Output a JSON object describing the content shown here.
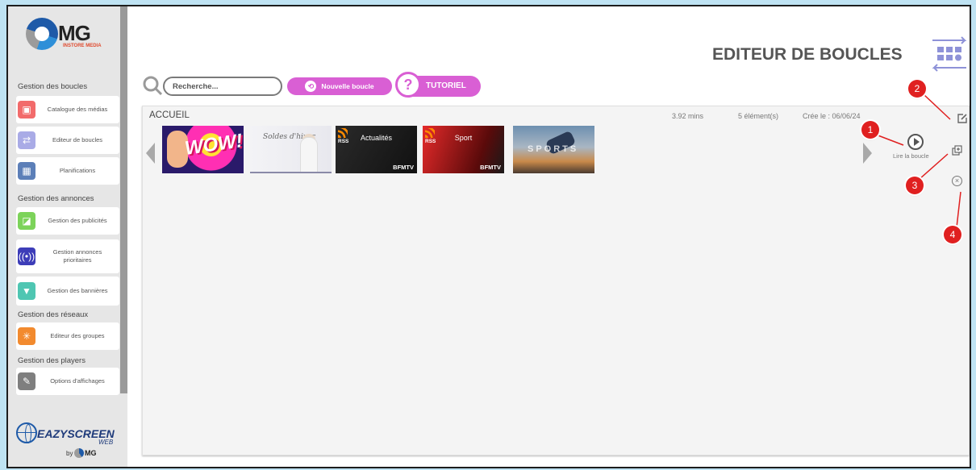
{
  "brand": {
    "logo_text": "MG",
    "logo_sub": "INSTORE MEDIA",
    "footer_brand": "EAZYSCREEN",
    "footer_brand_sub": "WEB",
    "footer_by": "by",
    "footer_mg": "MG"
  },
  "header": {
    "title": "EDITEUR DE BOUCLES"
  },
  "toolbar": {
    "search_placeholder": "Recherche...",
    "new_loop_label": "Nouvelle boucle",
    "tutorial_label": "TUTORIEL",
    "tutorial_icon": "?"
  },
  "sidebar": {
    "sections": [
      {
        "title": "Gestion des boucles",
        "items": [
          {
            "label": "Catalogue des médias",
            "icon": "media-catalog-icon",
            "color": "#f26b6b"
          },
          {
            "label": "Editeur de boucles",
            "icon": "loop-editor-icon",
            "color": "#a9abe6"
          },
          {
            "label": "Planifications",
            "icon": "calendar-icon",
            "color": "#5c7fb8"
          }
        ]
      },
      {
        "title": "Gestion des annonces",
        "items": [
          {
            "label": "Gestion des publicités",
            "icon": "ads-icon",
            "color": "#7cd35a"
          },
          {
            "label": "Gestion annonces prioritaires",
            "icon": "broadcast-icon",
            "color": "#3d3db8"
          },
          {
            "label": "Gestion des bannières",
            "icon": "banner-icon",
            "color": "#4fc6b2"
          }
        ]
      },
      {
        "title": "Gestion des réseaux",
        "items": [
          {
            "label": "Editeur des groupes",
            "icon": "groups-icon",
            "color": "#f28a2e"
          }
        ]
      },
      {
        "title": "Gestion des players",
        "items": [
          {
            "label": "Options d'affichages",
            "icon": "brush-icon",
            "color": "#7f7f7f"
          }
        ]
      }
    ]
  },
  "loop": {
    "name": "ACCUEIL",
    "duration": "3.92 mins",
    "elements": "5 élément(s)",
    "created": "Crée le : 06/06/24",
    "play_label": "Lire la boucle",
    "thumbnails": [
      {
        "kind": "image",
        "text": "WOW!"
      },
      {
        "kind": "image",
        "text": "Soldes d'hiver"
      },
      {
        "kind": "rss",
        "rss": "RSS",
        "name": "Actualités",
        "source": "BFMTV"
      },
      {
        "kind": "rss",
        "rss": "RSS",
        "name": "Sport",
        "source": "BFMTV"
      },
      {
        "kind": "image",
        "text": "SPORTS"
      }
    ]
  },
  "annotations": [
    "1",
    "2",
    "3",
    "4"
  ],
  "colors": {
    "accent": "#d95fd4",
    "marker": "#e02020",
    "background": "#bfe3f3"
  }
}
